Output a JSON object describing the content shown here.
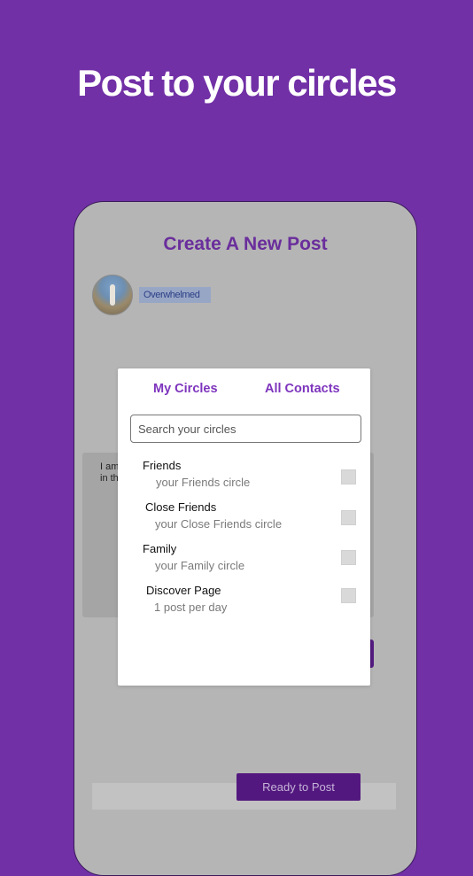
{
  "headline": "Post to your circles",
  "screen": {
    "title": "Create A New Post",
    "mood_tag": "Overwhelmed",
    "text_line_1": "I am",
    "text_line_2": "in th",
    "ready_button": "Ready to Post"
  },
  "modal": {
    "tabs": [
      "My Circles",
      "All Contacts"
    ],
    "search_placeholder": "Search your circles",
    "circles": [
      {
        "name": "Friends",
        "description": "your Friends circle",
        "checked": false
      },
      {
        "name": "Close Friends",
        "description": "your Close Friends circle",
        "checked": false
      },
      {
        "name": "Family",
        "description": "your Family circle",
        "checked": false
      },
      {
        "name": "Discover Page",
        "description": "1 post per day",
        "checked": false
      }
    ]
  },
  "colors": {
    "background": "#7130a6",
    "accent": "#7e34bd",
    "button": "#53187f"
  }
}
